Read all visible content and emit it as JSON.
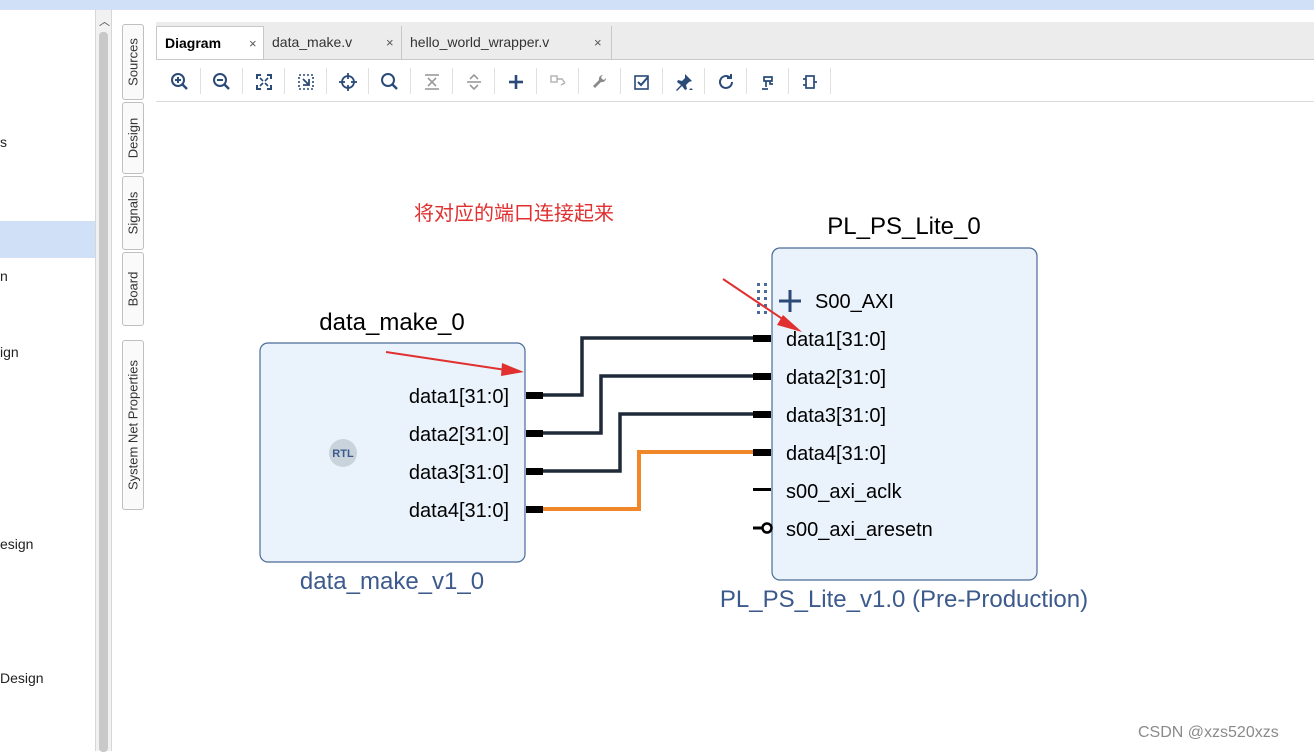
{
  "left_panel": {
    "items": [
      {
        "text": "s"
      },
      {
        "text": "n"
      },
      {
        "text": "ign"
      },
      {
        "text": "esign"
      },
      {
        "text": "Design"
      }
    ]
  },
  "side_tabs": [
    "Sources",
    "Design",
    "Signals",
    "Board",
    "System Net Properties"
  ],
  "tabs": [
    {
      "label": "Diagram",
      "close": "×"
    },
    {
      "label": "data_make.v",
      "close": "×"
    },
    {
      "label": "hello_world_wrapper.v",
      "close": "×"
    }
  ],
  "annotation": "将对应的端口连接起来",
  "blocks": {
    "data_make": {
      "instance": "data_make_0",
      "type_name": "data_make_v1_0",
      "badge": "RTL",
      "ports": [
        "data1[31:0]",
        "data2[31:0]",
        "data3[31:0]",
        "data4[31:0]"
      ]
    },
    "pl_ps": {
      "instance": "PL_PS_Lite_0",
      "type_name": "PL_PS_Lite_v1.0 (Pre-Production)",
      "bus": "S00_AXI",
      "ports": [
        "data1[31:0]",
        "data2[31:0]",
        "data3[31:0]",
        "data4[31:0]",
        "s00_axi_aclk",
        "s00_axi_aresetn"
      ]
    }
  },
  "colors": {
    "wire": "#1e2a38",
    "wire_selected": "#f0882a",
    "block_fill": "#eaf3fc",
    "block_border": "#4a6a99",
    "type_label": "#3c5a8c",
    "annotation": "#e03030"
  },
  "watermark": "CSDN @xzs520xzs"
}
